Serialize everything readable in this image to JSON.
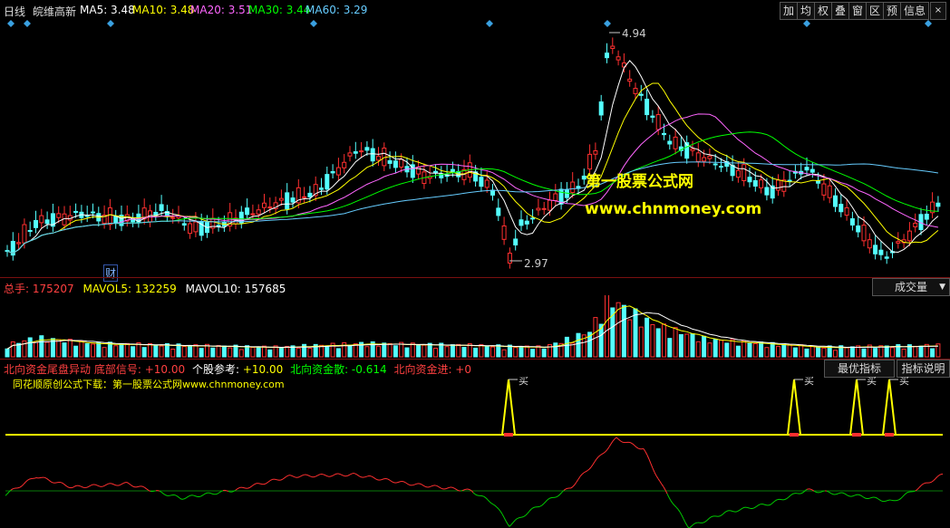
{
  "header": {
    "period": "日线",
    "stock_name": "皖维高新",
    "ma": [
      {
        "label": "MA5: 3.48",
        "color": "#ffffff"
      },
      {
        "label": "MA10: 3.48",
        "color": "#ffff00"
      },
      {
        "label": "MA20: 3.51",
        "color": "#ff66ff"
      },
      {
        "label": "MA30: 3.44",
        "color": "#00ff00"
      },
      {
        "label": "MA60: 3.29",
        "color": "#66ccff"
      }
    ],
    "toolbar": [
      "加",
      "均",
      "权",
      "叠",
      "窗",
      "区",
      "预",
      "信息"
    ]
  },
  "price_panel": {
    "high_label": "4.94",
    "low_label": "2.97",
    "cai_label": "财",
    "watermark_name": "第一股票公式网",
    "watermark_url": "www.chnmoney.com"
  },
  "volume_panel": {
    "total": {
      "label": "总手: ",
      "value": "175207"
    },
    "mavol5": "MAVOL5: 132259",
    "mavol10": "MAVOL10: 157685",
    "selector": "成交量"
  },
  "indicator_panel": {
    "name": "北向资金尾盘异动",
    "signal": {
      "label": "底部信号: ",
      "value": "+10.00"
    },
    "ref": {
      "label": "个股参考: ",
      "value": "+10.00"
    },
    "scatter": {
      "label": "北向资金散: ",
      "value": "-0.614"
    },
    "inflow": {
      "label": "北向资金进: ",
      "value": "+0"
    },
    "best_button": "最优指标",
    "help_button": "指标说明",
    "source_text": "同花顺原创公式下载：第一股票公式网www.chnmoney.com",
    "buy_label": "买",
    "buy_count": 4
  },
  "colors": {
    "up": "#ff3030",
    "down": "#54ffff",
    "separator": "#7a1010",
    "signal": "#ffff00"
  }
}
